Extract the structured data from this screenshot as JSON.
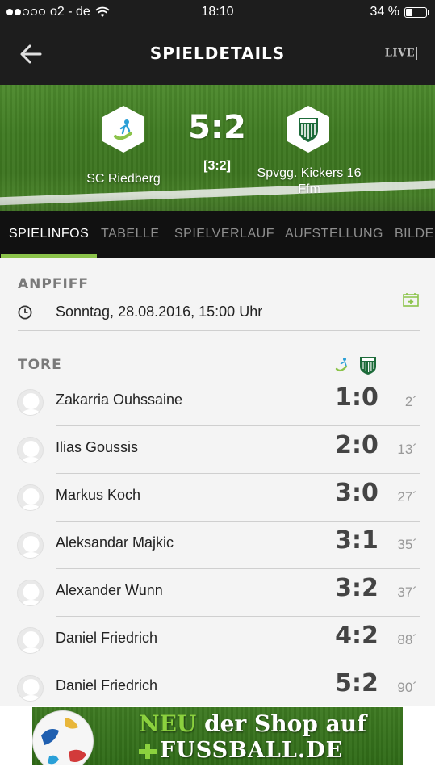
{
  "status_bar": {
    "carrier": "o2 - de",
    "time": "18:10",
    "battery": "34 %",
    "battery_level": 0.34,
    "signal_bars": 2
  },
  "header": {
    "title": "SPIELDETAILS",
    "live_label": "LIVE"
  },
  "match": {
    "home_team": "SC Riedberg",
    "away_team_line1": "Spvgg. Kickers 16",
    "away_team_line2": "Ffm",
    "score": "5:2",
    "halftime": "[3:2]"
  },
  "tabs": [
    {
      "label": "SPIELINFOS",
      "active": true
    },
    {
      "label": "TABELLE",
      "active": false
    },
    {
      "label": "SPIELVERLAUF",
      "active": false
    },
    {
      "label": "AUFSTELLUNG",
      "active": false
    },
    {
      "label": "BILDER",
      "active": false
    }
  ],
  "kickoff": {
    "heading": "ANPFIFF",
    "datetime": "Sonntag, 28.08.2016, 15:00 Uhr"
  },
  "goals": {
    "heading": "TORE",
    "rows": [
      {
        "name": "Zakarria Ouhssaine",
        "score": "1:0",
        "minute": "2´"
      },
      {
        "name": "Ilias Goussis",
        "score": "2:0",
        "minute": "13´"
      },
      {
        "name": "Markus Koch",
        "score": "3:0",
        "minute": "27´"
      },
      {
        "name": "Aleksandar Majkic",
        "score": "3:1",
        "minute": "35´"
      },
      {
        "name": "Alexander Wunn",
        "score": "3:2",
        "minute": "37´"
      },
      {
        "name": "Daniel Friedrich",
        "score": "4:2",
        "minute": "88´"
      },
      {
        "name": "Daniel Friedrich",
        "score": "5:2",
        "minute": "90´"
      }
    ]
  },
  "banner": {
    "neu": "NEU",
    "line1_rest": " der Shop auf",
    "line2": "FUSSBALL.DE"
  },
  "colors": {
    "accent_green": "#8bc34a",
    "header_bg": "#1d1d1d",
    "tabs_bg": "#111111",
    "content_bg": "#f4f4f4"
  },
  "icons": {
    "back": "arrow-left-icon",
    "clock": "clock-icon",
    "calendar_add": "calendar-add-icon"
  }
}
